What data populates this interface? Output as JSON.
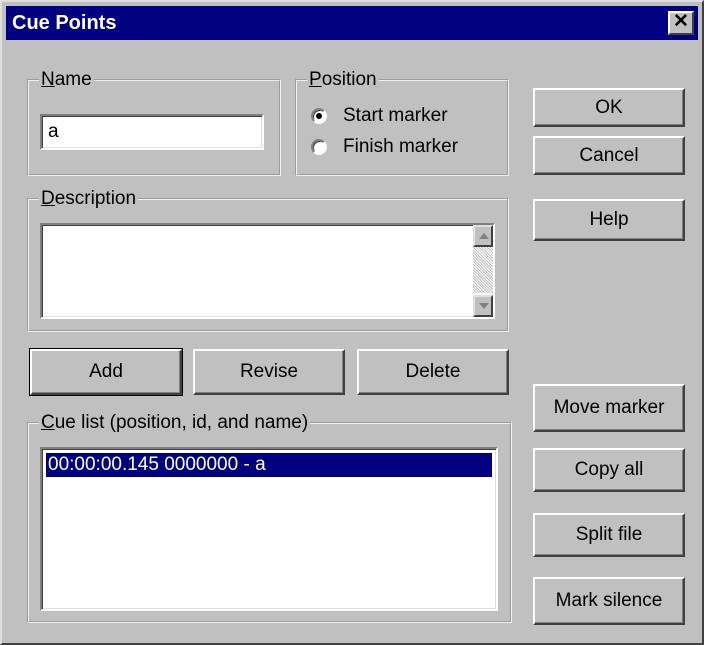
{
  "window": {
    "title": "Cue Points",
    "close_glyph": "✕"
  },
  "name_group": {
    "legend_accel": "N",
    "legend_rest": "ame",
    "value": "a"
  },
  "position_group": {
    "legend_accel": "P",
    "legend_rest": "osition",
    "options": [
      {
        "label": "Start marker",
        "selected": true
      },
      {
        "label": "Finish marker",
        "selected": false
      }
    ]
  },
  "description_group": {
    "legend_accel": "D",
    "legend_rest": "escription",
    "value": ""
  },
  "buttons": {
    "ok": "OK",
    "cancel": "Cancel",
    "help": "Help",
    "add": "Add",
    "revise": "Revise",
    "delete": "Delete",
    "move_marker": "Move marker",
    "copy_all": "Copy all",
    "split_file": "Split file",
    "mark_silence": "Mark silence"
  },
  "cue_list": {
    "legend_accel": "C",
    "legend_rest": "ue list (position, id, and name)",
    "items": [
      "00:00:00.145  0000000 - a"
    ]
  },
  "colors": {
    "face": "#c0c0c0",
    "titlebar": "#000080",
    "selection": "#000080"
  }
}
